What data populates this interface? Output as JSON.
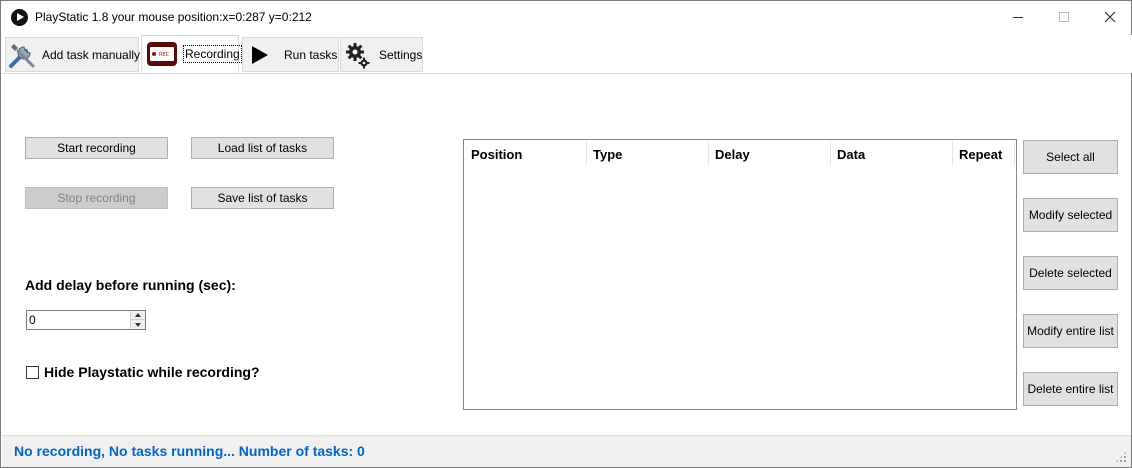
{
  "window": {
    "title": "PlayStatic 1.8 your mouse position:x=0:287 y=0:212"
  },
  "tabs": [
    {
      "label": "Add task manually",
      "icon": "tools-icon"
    },
    {
      "label": "Recording",
      "icon": "record-icon",
      "record_badge": "REC"
    },
    {
      "label": "Run tasks",
      "icon": "play-icon"
    },
    {
      "label": "Settings",
      "icon": "gear-icon"
    }
  ],
  "selected_tab": "Recording",
  "recording": {
    "start_label": "Start recording",
    "stop_label": "Stop recording",
    "load_label": "Load list of tasks",
    "save_label": "Save list of tasks",
    "delay_label": "Add delay before running (sec):",
    "delay_value": "0",
    "hide_label": "Hide Playstatic while recording?",
    "hide_checked": false
  },
  "task_list": {
    "columns": [
      "Position",
      "Type",
      "Delay",
      "Data",
      "Repeat"
    ],
    "rows": []
  },
  "list_actions": {
    "select_all": "Select all",
    "modify_selected": "Modify selected",
    "delete_selected": "Delete selected",
    "modify_entire": "Modify entire list",
    "delete_entire": "Delete entire list"
  },
  "status": {
    "text": "No recording, No tasks running... Number of tasks: 0",
    "color": "#0066cc"
  },
  "colors": {
    "record_icon_bg": "#8b0000",
    "status_text": "#0066cc"
  }
}
